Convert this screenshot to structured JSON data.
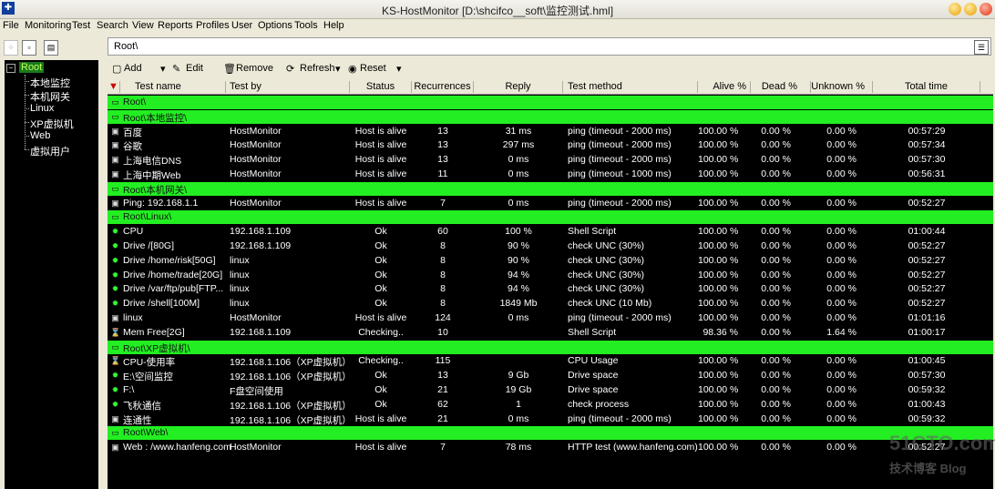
{
  "window": {
    "title": "KS-HostMonitor  [D:\\shcifco__soft\\监控测试.hml]"
  },
  "menu": [
    "File",
    "Monitoring",
    "Test",
    "Search",
    "View",
    "Reports",
    "Profiles",
    "User",
    "Options",
    "Tools",
    "Help"
  ],
  "path": {
    "value": "Root\\"
  },
  "tree": {
    "root": "Root",
    "children": [
      "本地监控",
      "本机网关",
      "Linux",
      "XP虚拟机",
      "Web",
      "虚拟用户"
    ]
  },
  "toolbar": {
    "add": "Add",
    "edit": "Edit",
    "remove": "Remove",
    "refresh": "Refresh",
    "reset": "Reset"
  },
  "columns": [
    "Test name",
    "Test by",
    "Status",
    "Recurrences",
    "Reply",
    "Test method",
    "Alive %",
    "Dead %",
    "Unknown %",
    "Total time"
  ],
  "rows": [
    {
      "folder": "Root\\"
    },
    {
      "folder": "Root\\本地监控\\"
    },
    {
      "name": "百度",
      "by": "HostMonitor",
      "status": "Host is alive",
      "rec": "13",
      "reply": "31 ms",
      "method": "ping (timeout - 2000 ms)",
      "alive": "100.00 %",
      "dead": "0.00 %",
      "unk": "0.00 %",
      "total": "00:57:29",
      "icon": "host"
    },
    {
      "name": "谷歌",
      "by": "HostMonitor",
      "status": "Host is alive",
      "rec": "13",
      "reply": "297 ms",
      "method": "ping (timeout - 2000 ms)",
      "alive": "100.00 %",
      "dead": "0.00 %",
      "unk": "0.00 %",
      "total": "00:57:34",
      "icon": "host"
    },
    {
      "name": "上海电信DNS",
      "by": "HostMonitor",
      "status": "Host is alive",
      "rec": "13",
      "reply": "0 ms",
      "method": "ping (timeout - 2000 ms)",
      "alive": "100.00 %",
      "dead": "0.00 %",
      "unk": "0.00 %",
      "total": "00:57:30",
      "icon": "host"
    },
    {
      "name": "上海中期Web",
      "by": "HostMonitor",
      "status": "Host is alive",
      "rec": "11",
      "reply": "0 ms",
      "method": "ping (timeout - 1000 ms)",
      "alive": "100.00 %",
      "dead": "0.00 %",
      "unk": "0.00 %",
      "total": "00:56:31",
      "icon": "host"
    },
    {
      "folder": "Root\\本机网关\\"
    },
    {
      "name": "Ping: 192.168.1.1",
      "by": "HostMonitor",
      "status": "Host is alive",
      "rec": "7",
      "reply": "0 ms",
      "method": "ping (timeout - 2000 ms)",
      "alive": "100.00 %",
      "dead": "0.00 %",
      "unk": "0.00 %",
      "total": "00:52:27",
      "icon": "host"
    },
    {
      "folder": "Root\\Linux\\"
    },
    {
      "name": "CPU",
      "by": "192.168.1.109",
      "status": "Ok",
      "rec": "60",
      "reply": "100 %",
      "method": "Shell Script",
      "alive": "100.00 %",
      "dead": "0.00 %",
      "unk": "0.00 %",
      "total": "01:00:44",
      "icon": "gear"
    },
    {
      "name": "Drive  /[80G]",
      "by": "192.168.1.109",
      "status": "Ok",
      "rec": "8",
      "reply": "90 %",
      "method": "check UNC (30%)",
      "alive": "100.00 %",
      "dead": "0.00 %",
      "unk": "0.00 %",
      "total": "00:52:27",
      "icon": "gear"
    },
    {
      "name": "Drive  /home/risk[50G]",
      "by": "linux",
      "status": "Ok",
      "rec": "8",
      "reply": "90 %",
      "method": "check UNC (30%)",
      "alive": "100.00 %",
      "dead": "0.00 %",
      "unk": "0.00 %",
      "total": "00:52:27",
      "icon": "gear"
    },
    {
      "name": "Drive  /home/trade[20G]",
      "by": "linux",
      "status": "Ok",
      "rec": "8",
      "reply": "94 %",
      "method": "check UNC (30%)",
      "alive": "100.00 %",
      "dead": "0.00 %",
      "unk": "0.00 %",
      "total": "00:52:27",
      "icon": "gear"
    },
    {
      "name": "Drive  /var/ftp/pub[FTP...",
      "by": "linux",
      "status": "Ok",
      "rec": "8",
      "reply": "94 %",
      "method": "check UNC (30%)",
      "alive": "100.00 %",
      "dead": "0.00 %",
      "unk": "0.00 %",
      "total": "00:52:27",
      "icon": "gear"
    },
    {
      "name": "Drive /shell[100M]",
      "by": "linux",
      "status": "Ok",
      "rec": "8",
      "reply": "1849 Mb",
      "method": "check UNC (10 Mb)",
      "alive": "100.00 %",
      "dead": "0.00 %",
      "unk": "0.00 %",
      "total": "00:52:27",
      "icon": "gear"
    },
    {
      "name": "linux",
      "by": "HostMonitor",
      "status": "Host is alive",
      "rec": "124",
      "reply": "0 ms",
      "method": "ping (timeout - 2000 ms)",
      "alive": "100.00 %",
      "dead": "0.00 %",
      "unk": "0.00 %",
      "total": "01:01:16",
      "icon": "host"
    },
    {
      "name": "Mem Free[2G]",
      "by": "192.168.1.109",
      "status": "Checking..",
      "rec": "10",
      "reply": "",
      "method": "Shell Script",
      "alive": "98.36 %",
      "dead": "0.00 %",
      "unk": "1.64 %",
      "total": "01:00:17",
      "icon": "hourglass"
    },
    {
      "folder": "Root\\XP虚拟机\\"
    },
    {
      "name": "CPU-使用率",
      "by": "192.168.1.106（XP虚拟机）",
      "status": "Checking..",
      "rec": "115",
      "reply": "",
      "method": "CPU Usage",
      "alive": "100.00 %",
      "dead": "0.00 %",
      "unk": "0.00 %",
      "total": "01:00:45",
      "icon": "hourglass"
    },
    {
      "name": "E:\\空间监控",
      "by": "192.168.1.106（XP虚拟机）",
      "status": "Ok",
      "rec": "13",
      "reply": "9 Gb",
      "method": "Drive space",
      "alive": "100.00 %",
      "dead": "0.00 %",
      "unk": "0.00 %",
      "total": "00:57:30",
      "icon": "gear"
    },
    {
      "name": "F:\\",
      "by": "F盘空间使用",
      "status": "Ok",
      "rec": "21",
      "reply": "19 Gb",
      "method": "Drive space",
      "alive": "100.00 %",
      "dead": "0.00 %",
      "unk": "0.00 %",
      "total": "00:59:32",
      "icon": "gear"
    },
    {
      "name": "飞秋通信",
      "by": "192.168.1.106（XP虚拟机）",
      "status": "Ok",
      "rec": "62",
      "reply": "1",
      "method": "check process",
      "alive": "100.00 %",
      "dead": "0.00 %",
      "unk": "0.00 %",
      "total": "01:00:43",
      "icon": "gear"
    },
    {
      "name": "连通性",
      "by": "192.168.1.106（XP虚拟机）",
      "status": "Host is alive",
      "rec": "21",
      "reply": "0 ms",
      "method": "ping (timeout - 2000 ms)",
      "alive": "100.00 %",
      "dead": "0.00 %",
      "unk": "0.00 %",
      "total": "00:59:32",
      "icon": "host"
    },
    {
      "folder": "Root\\Web\\"
    },
    {
      "name": "Web : /www.hanfeng.com",
      "by": "HostMonitor",
      "status": "Host is alive",
      "rec": "7",
      "reply": "78 ms",
      "method": "HTTP test (www.hanfeng.com)",
      "alive": "100.00 %",
      "dead": "0.00 %",
      "unk": "0.00 %",
      "total": "00:52:27",
      "icon": "host"
    }
  ],
  "watermark": {
    "line1": "51CTO.com",
    "line2": "技术博客  Blog"
  }
}
